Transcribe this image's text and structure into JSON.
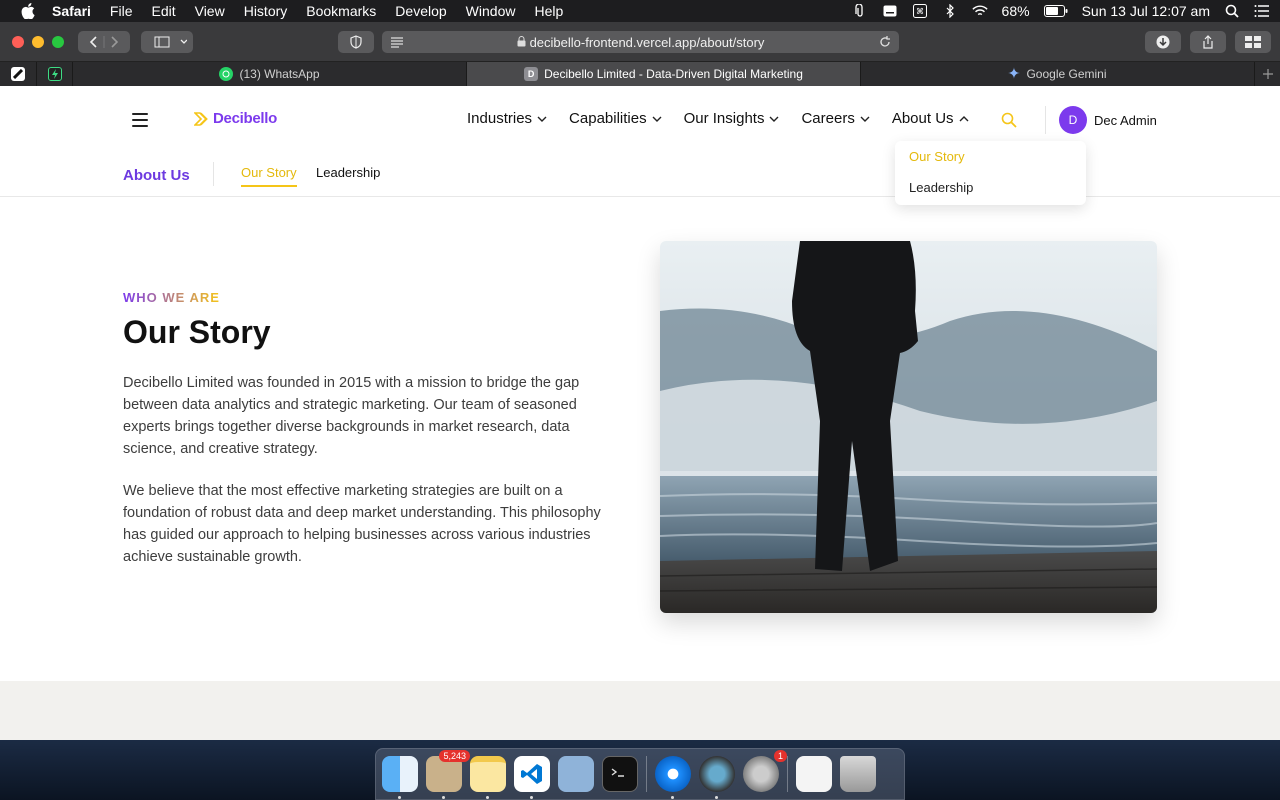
{
  "menubar": {
    "app_name": "Safari",
    "items": [
      "File",
      "Edit",
      "View",
      "History",
      "Bookmarks",
      "Develop",
      "Window",
      "Help"
    ],
    "battery": "68%",
    "datetime": "Sun 13 Jul  12:07 am"
  },
  "browser": {
    "url": "decibello-frontend.vercel.app/about/story",
    "tabs": [
      {
        "label": "(13) WhatsApp"
      },
      {
        "label": "Decibello Limited - Data-Driven Digital Marketing",
        "favicon_letter": "D"
      },
      {
        "label": "Google Gemini"
      }
    ]
  },
  "site": {
    "logo_text": "Decibello",
    "nav": [
      "Industries",
      "Capabilities",
      "Our Insights",
      "Careers",
      "About Us"
    ],
    "user_initial": "D",
    "user_name": "Dec Admin",
    "dropdown": [
      "Our Story",
      "Leadership"
    ],
    "subnav": {
      "title": "About Us",
      "tabs": [
        "Our Story",
        "Leadership"
      ]
    },
    "eyebrow": "WHO WE ARE",
    "title": "Our Story",
    "paragraphs": [
      "Decibello Limited was founded in 2015 with a mission to bridge the gap between data analytics and strategic marketing. Our team of seasoned experts brings together diverse backgrounds in market research, data science, and creative strategy.",
      "We believe that the most effective marketing strategies are built on a foundation of robust data and deep market understanding. This philosophy has guided our approach to helping businesses across various industries achieve sustainable growth."
    ]
  },
  "dock": {
    "mail_badge": "5,243",
    "settings_badge": "1"
  },
  "colors": {
    "brand_purple": "#7c3aed",
    "brand_yellow": "#f5c518"
  }
}
